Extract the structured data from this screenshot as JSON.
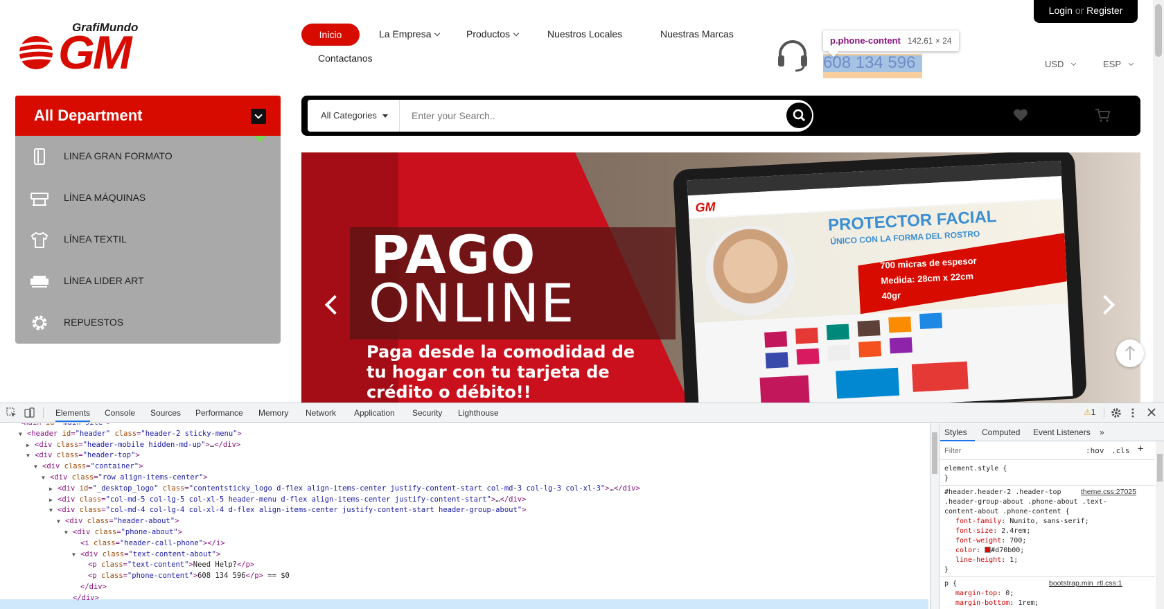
{
  "header": {
    "logo_brand": "GrafiMundo",
    "logo_mark": "GM",
    "nav": [
      {
        "label": "Inicio",
        "active": true
      },
      {
        "label": "La Empresa",
        "dropdown": true
      },
      {
        "label": "Productos",
        "dropdown": true
      },
      {
        "label": "Nuestros Locales"
      },
      {
        "label": "Nuestras Marcas"
      },
      {
        "label": "Contactanos"
      }
    ],
    "inspect_tooltip": {
      "selector": "p.phone-content",
      "size": "142.61 × 24"
    },
    "phone": "608 134 596",
    "currency": "USD",
    "language": "ESP",
    "login": "Login",
    "or": "or",
    "register": "Register"
  },
  "department": {
    "title": "All Department",
    "items": [
      {
        "label": "LINEA GRAN FORMATO",
        "icon": "panel-icon"
      },
      {
        "label": "LÍNEA MÁQUINAS",
        "icon": "plotter-icon"
      },
      {
        "label": "LÍNEA TEXTIL",
        "icon": "tshirt-icon"
      },
      {
        "label": "LÍNEA LIDER ART",
        "icon": "machine-icon"
      },
      {
        "label": "REPUESTOS",
        "icon": "gear-icon"
      }
    ]
  },
  "search": {
    "category": "All Categories",
    "placeholder": "Enter your Search.."
  },
  "banner": {
    "headline1": "PAGO",
    "headline2": "ONLINE",
    "description": "Paga desde la comodidad de tu hogar con tu tarjeta de crédito o débito!!",
    "screen_logo": "GM",
    "screen_title": "PROTECTOR FACIAL",
    "screen_subtitle": "ÚNICO CON LA FORMA DEL ROSTRO",
    "screen_feature1": "700 micras de espesor",
    "screen_feature2": "Medida: 28cm x 22cm",
    "screen_feature3": "40gr"
  },
  "devtools": {
    "tabs": [
      "Elements",
      "Console",
      "Sources",
      "Performance",
      "Memory",
      "Network",
      "Application",
      "Security",
      "Lighthouse"
    ],
    "warning_count": "1",
    "styles_tabs": [
      "Styles",
      "Computed",
      "Event Listeners"
    ],
    "filter_placeholder": "Filter",
    "hov": ":hov",
    "cls": ".cls",
    "element_style": "element.style {",
    "rule_selector_1": "#header.header-2 .header-top",
    "rule_selector_2": ".header-group-about .phone-about .text-",
    "rule_selector_3": "content-about .phone-content {",
    "rule_source": "theme.css:27025",
    "props": [
      {
        "name": "font-family",
        "value": "Nunito, sans-serif;"
      },
      {
        "name": "font-size",
        "value": "2.4rem;"
      },
      {
        "name": "font-weight",
        "value": "700;"
      },
      {
        "name": "color",
        "value": "#d70b00;"
      },
      {
        "name": "line-height",
        "value": "1;"
      }
    ],
    "p_selector": "p {",
    "p_source": "bootstrap.min_rtl.css:1",
    "p_props": [
      {
        "name": "margin-top",
        "value": "0;"
      },
      {
        "name": "margin-bottom",
        "value": "1rem;"
      }
    ],
    "dom_lines": [
      {
        "indent": 0,
        "arrow": "",
        "html": "<main id=\"main-site\">"
      },
      {
        "indent": 1,
        "arrow": "▼",
        "html": "<header id=\"header\" class=\"header-2 sticky-menu\">"
      },
      {
        "indent": 2,
        "arrow": "▶",
        "html": "<div class=\"header-mobile hidden-md-up\">…</div>"
      },
      {
        "indent": 2,
        "arrow": "▼",
        "html": "<div class=\"header-top\">"
      },
      {
        "indent": 3,
        "arrow": "▼",
        "html": "<div class=\"container\">"
      },
      {
        "indent": 4,
        "arrow": "▼",
        "html": "<div class=\"row align-items-center\">"
      },
      {
        "indent": 5,
        "arrow": "▶",
        "html": "<div id=\"_desktop_logo\" class=\"contentsticky_logo d-flex align-items-center justify-content-start col-md-3 col-lg-3 col-xl-3\">…</div>"
      },
      {
        "indent": 5,
        "arrow": "▶",
        "html": "<div class=\"col-md-5 col-lg-5 col-xl-5 header-menu d-flex align-items-center justify-content-start\">…</div>"
      },
      {
        "indent": 5,
        "arrow": "▼",
        "html": "<div class=\"col-md-4 col-lg-4 col-xl-4 d-flex align-items-center justify-content-start header-group-about\">"
      },
      {
        "indent": 6,
        "arrow": "▼",
        "html": "<div class=\"header-about\">"
      },
      {
        "indent": 7,
        "arrow": "▼",
        "html": "<div class=\"phone-about\">"
      },
      {
        "indent": 8,
        "arrow": "",
        "html": "<i class=\"header-call-phone\"></i>"
      },
      {
        "indent": 8,
        "arrow": "▼",
        "html": "<div class=\"text-content-about\">"
      },
      {
        "indent": 9,
        "arrow": "",
        "html": "<p class=\"text-content\">Need Help?</p>"
      },
      {
        "indent": 9,
        "arrow": "",
        "html": "<p class=\"phone-content\">608 134 596</p> == $0"
      },
      {
        "indent": 8,
        "arrow": "",
        "html": "</div>"
      },
      {
        "indent": 7,
        "arrow": "",
        "html": "</div>"
      }
    ]
  }
}
